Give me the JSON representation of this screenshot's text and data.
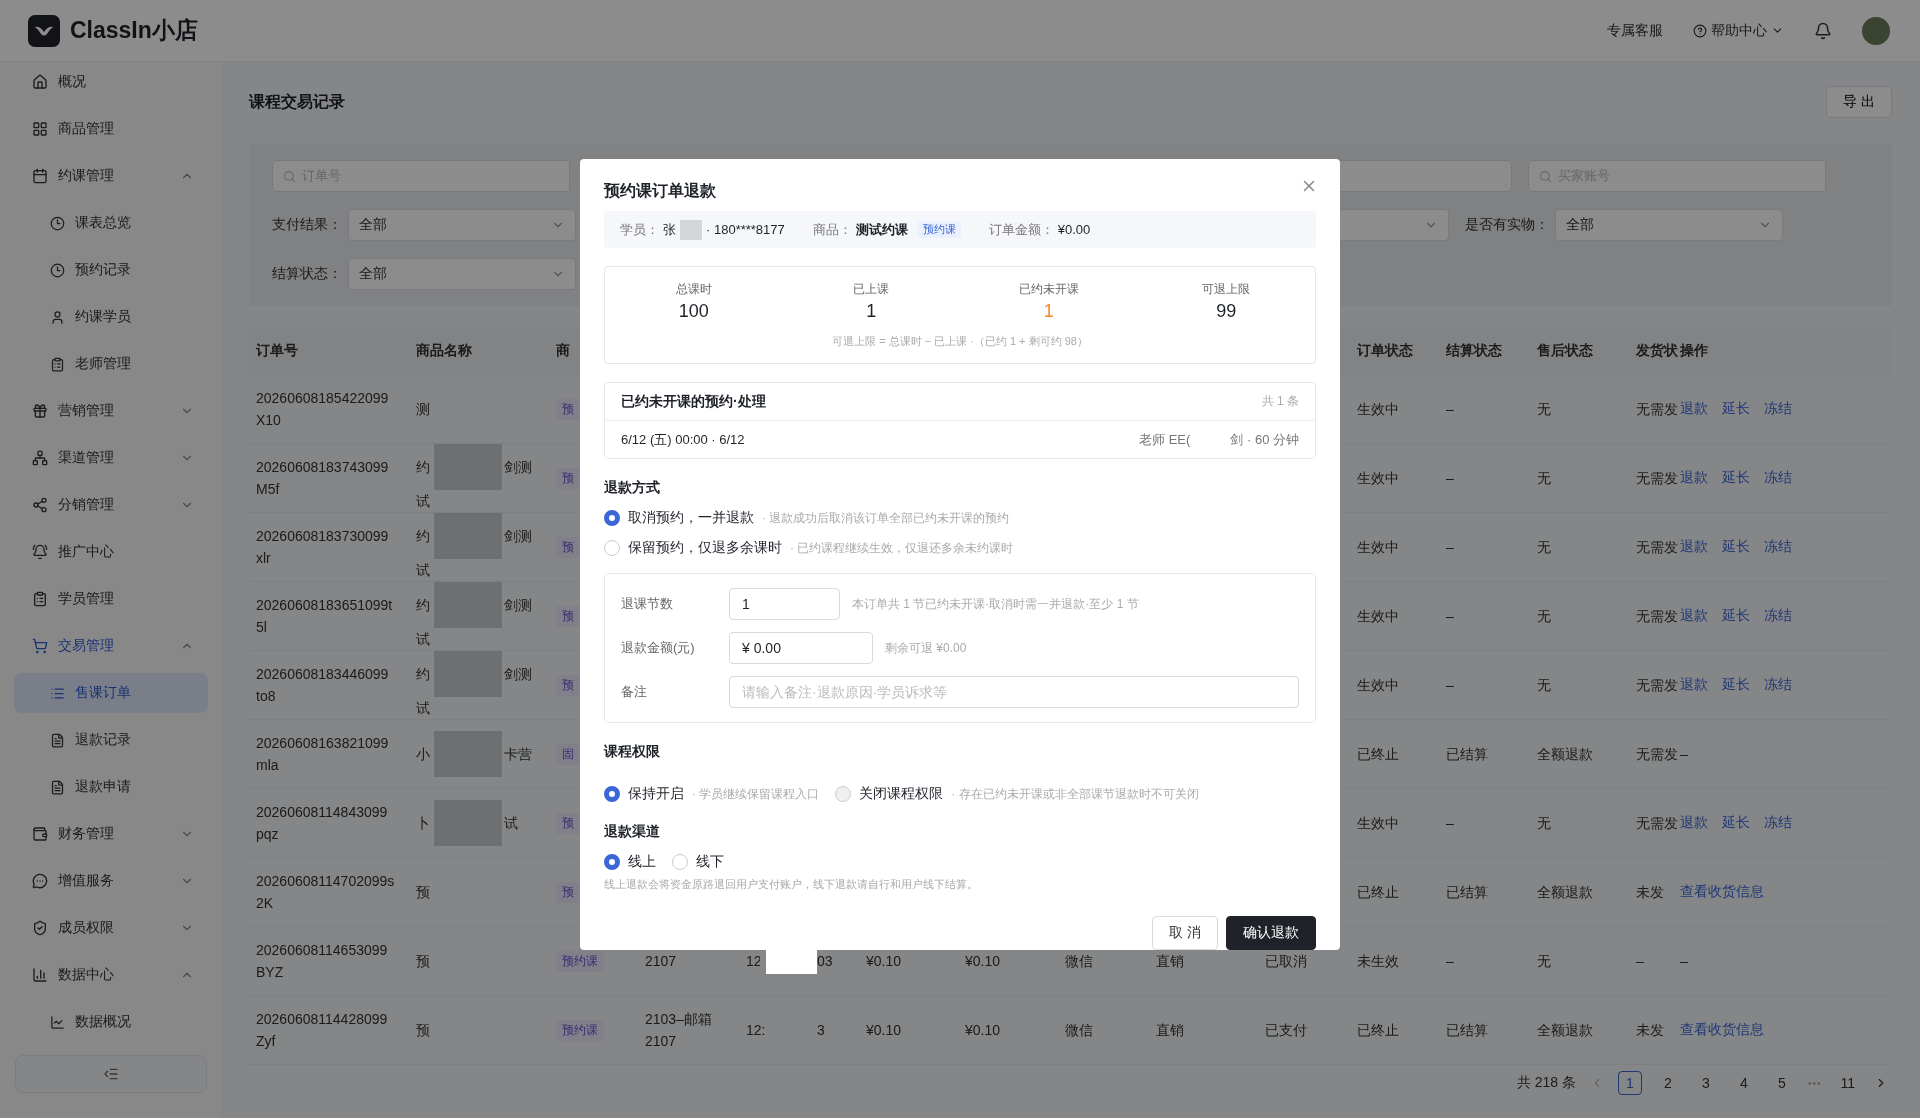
{
  "header": {
    "brand": "ClassIn小店",
    "service": "专属客服",
    "help": "帮助中心"
  },
  "sidebar": {
    "items": [
      {
        "label": "概况",
        "selected": false
      },
      {
        "label": "商品管理",
        "selected": false
      },
      {
        "label": "约课管理",
        "selected": false,
        "expanded": true,
        "children": [
          {
            "label": "课表总览",
            "selected": false
          },
          {
            "label": "预约记录",
            "selected": false
          },
          {
            "label": "约课学员",
            "selected": false
          },
          {
            "label": "老师管理",
            "selected": false
          }
        ]
      },
      {
        "label": "营销管理",
        "selected": false,
        "expanded": false
      },
      {
        "label": "渠道管理",
        "selected": false,
        "expanded": false
      },
      {
        "label": "分销管理",
        "selected": false,
        "expanded": false
      },
      {
        "label": "推广中心",
        "selected": false
      },
      {
        "label": "学员管理",
        "selected": false
      },
      {
        "label": "交易管理",
        "selected": false,
        "expanded": true,
        "children": [
          {
            "label": "售课订单",
            "selected": true
          },
          {
            "label": "退款记录",
            "selected": false
          },
          {
            "label": "退款申请",
            "selected": false
          }
        ]
      },
      {
        "label": "财务管理",
        "selected": false,
        "expanded": false
      },
      {
        "label": "增值服务",
        "selected": false,
        "expanded": false
      },
      {
        "label": "成员权限",
        "selected": false,
        "expanded": false
      },
      {
        "label": "数据中心",
        "selected": false,
        "expanded": true,
        "children": [
          {
            "label": "数据概况",
            "selected": false
          }
        ]
      }
    ]
  },
  "page": {
    "title": "课程交易记录",
    "export_button": "导 出"
  },
  "filters": {
    "row_1": [
      {
        "kind": "search",
        "placeholder": "订单号"
      },
      {
        "kind": "blank"
      },
      {
        "kind": "search",
        "placeholder": "买家账号"
      }
    ],
    "row_2": [
      {
        "kind": "select",
        "label": "支付结果：",
        "value": "全部"
      },
      {
        "kind": "blank_select"
      },
      {
        "kind": "select",
        "label": "是否有实物：",
        "value": "全部"
      }
    ],
    "row_3": [
      {
        "kind": "select",
        "label": "结算状态：",
        "value": "全部"
      }
    ]
  },
  "table": {
    "columns": {
      "order_no": "订单号",
      "name": "商品名称",
      "type": "商",
      "order_status": "订单状态",
      "settle_status": "结算状态",
      "aftersale_status": "售后状态",
      "shipping_status": "发货状",
      "actions": "操作"
    },
    "rows": [
      {
        "order_no": "20260608185422099\nX10",
        "name": {
          "head": "测"
        },
        "type": "预",
        "order_status": "生效中",
        "settle_status": "–",
        "aftersale_status": "无",
        "shipping_status": "无需发",
        "actions": [
          {
            "label": "退款",
            "kind": "link"
          },
          {
            "label": "延长",
            "kind": "link"
          },
          {
            "label": "冻结",
            "kind": "link"
          }
        ]
      },
      {
        "order_no": "20260608183743099\nM5f",
        "name": {
          "head": "约",
          "tail": "剑测",
          "second_line": "试"
        },
        "type": "预",
        "order_status": "生效中",
        "settle_status": "–",
        "aftersale_status": "无",
        "shipping_status": "无需发",
        "actions": [
          {
            "label": "退款",
            "kind": "link"
          },
          {
            "label": "延长",
            "kind": "link"
          },
          {
            "label": "冻结",
            "kind": "link"
          }
        ]
      },
      {
        "order_no": "20260608183730099\nxlr",
        "name": {
          "head": "约",
          "tail": "剑测",
          "second_line": "试"
        },
        "type": "预",
        "order_status": "生效中",
        "settle_status": "–",
        "aftersale_status": "无",
        "shipping_status": "无需发",
        "actions": [
          {
            "label": "退款",
            "kind": "link"
          },
          {
            "label": "延长",
            "kind": "link"
          },
          {
            "label": "冻结",
            "kind": "link"
          }
        ]
      },
      {
        "order_no": "20260608183651099t\n5l",
        "name": {
          "head": "约",
          "tail": "剑测",
          "second_line": "试"
        },
        "type": "预",
        "order_status": "生效中",
        "settle_status": "–",
        "aftersale_status": "无",
        "shipping_status": "无需发",
        "actions": [
          {
            "label": "退款",
            "kind": "link"
          },
          {
            "label": "延长",
            "kind": "link"
          },
          {
            "label": "冻结",
            "kind": "link"
          }
        ]
      },
      {
        "order_no": "20260608183446099\nto8",
        "name": {
          "head": "约",
          "tail": "剑测",
          "second_line": "试"
        },
        "type": "预",
        "order_status": "生效中",
        "settle_status": "–",
        "aftersale_status": "无",
        "shipping_status": "无需发",
        "actions": [
          {
            "label": "退款",
            "kind": "link"
          },
          {
            "label": "延长",
            "kind": "link"
          },
          {
            "label": "冻结",
            "kind": "link"
          }
        ]
      },
      {
        "order_no": "20260608163821099\nmla",
        "name": {
          "head": "小",
          "tail": "卡营"
        },
        "type": "固",
        "order_status": "已终止",
        "settle_status": "已结算",
        "aftersale_status": "全额退款",
        "shipping_status": "无需发",
        "actions": [
          {
            "label": "–",
            "kind": "dash"
          }
        ]
      },
      {
        "order_no": "20260608114843099\npqz",
        "name": {
          "head": "卜",
          "tail": "试"
        },
        "type": "预",
        "order_status": "生效中",
        "settle_status": "–",
        "aftersale_status": "无",
        "shipping_status": "无需发",
        "actions": [
          {
            "label": "退款",
            "kind": "link"
          },
          {
            "label": "延长",
            "kind": "link"
          },
          {
            "label": "冻结",
            "kind": "link"
          }
        ]
      },
      {
        "order_no": "20260608114702099s\n2K",
        "name": {
          "head": "预"
        },
        "type": "预",
        "order_status": "已终止",
        "settle_status": "已结算",
        "aftersale_status": "全额退款",
        "shipping_status": "未发",
        "actions": [
          {
            "label": "查看收货信息",
            "kind": "link"
          }
        ]
      },
      {
        "order_no": "20260608114653099\nBYZ",
        "name": {
          "head": "预"
        },
        "type": "预约课",
        "column_4": "2107",
        "column_5": "12",
        "column_5_redacted": true,
        "column_6": "03",
        "column_7": "¥0.10",
        "column_8": "¥0.10",
        "column_9": "微信",
        "column_10": "直销",
        "column_11": "已取消",
        "order_status": "未生效",
        "settle_status": "–",
        "aftersale_status": "无",
        "shipping_status": "–",
        "actions": [
          {
            "label": "–",
            "kind": "dash"
          }
        ]
      },
      {
        "order_no": "20260608114428099\nZyf",
        "name": {
          "head": "预"
        },
        "type": "预约课",
        "column_4": "2103–邮箱\n2107",
        "column_5": "12:",
        "column_6": "3",
        "column_7": "¥0.10",
        "column_8": "¥0.10",
        "column_9": "微信",
        "column_10": "直销",
        "column_11": "已支付",
        "order_status": "已终止",
        "settle_status": "已结算",
        "aftersale_status": "全额退款",
        "shipping_status": "未发",
        "actions": [
          {
            "label": "查看收货信息",
            "kind": "link"
          }
        ]
      }
    ]
  },
  "pagination": {
    "total": "共 218 条",
    "pages": [
      {
        "label": "1",
        "kind": "page",
        "selected": true
      },
      {
        "label": "2",
        "kind": "page",
        "selected": false
      },
      {
        "label": "3",
        "kind": "page",
        "selected": false
      },
      {
        "label": "4",
        "kind": "page",
        "selected": false
      },
      {
        "label": "5",
        "kind": "page",
        "selected": false
      },
      {
        "label": "•••",
        "kind": "ellipsis"
      },
      {
        "label": "11",
        "kind": "page",
        "selected": false
      }
    ]
  },
  "refund_dialog": {
    "title": "预约课订单退款",
    "student_label": "学员：",
    "student_name": "张",
    "student_phone": "· 180****8177",
    "product_label": "商品：",
    "product_name": "测试约课",
    "product_tag": "预约课",
    "amount_label": "订单金额：",
    "amount": "¥0.00",
    "stats": [
      {
        "label": "总课时",
        "value": "100",
        "highlight": false
      },
      {
        "label": "已上课",
        "value": "1",
        "highlight": false
      },
      {
        "label": "已约未开课",
        "value": "1",
        "highlight": true
      },
      {
        "label": "可退上限",
        "value": "99",
        "highlight": false
      }
    ],
    "stats_note": "可退上限 = 总课时 − 已上课 ·（已约 1 + 剩可约 98）",
    "bookings": {
      "title": "已约未开课的预约·处理",
      "count": "共 1 条",
      "rows": [
        {
          "time": "6/12 (五) 00:00 · 6/12",
          "teacher": "老师 EE(",
          "detail": "剑 · 60 分钟"
        }
      ]
    },
    "refund_method": {
      "title": "退款方式",
      "options": [
        {
          "label": "取消预约，一并退款",
          "hint": "· 退款成功后取消该订单全部已约未开课的预约",
          "selected": true
        },
        {
          "label": "保留预约，仅退多余课时",
          "hint": "· 已约课程继续生效，仅退还多余未约课时",
          "selected": false
        }
      ]
    },
    "form": [
      {
        "label": "退课节数",
        "value": "1",
        "hint": "本订单共 1 节已约未开课·取消时需一并退款·至少 1 节",
        "kind": "short"
      },
      {
        "label": "退款金额(元)",
        "value": "¥ 0.00",
        "hint": "剩余可退 ¥0.00",
        "kind": "medium"
      },
      {
        "label": "备注",
        "placeholder": "请输入备注·退款原因·学员诉求等",
        "kind": "wide"
      }
    ],
    "course_access": {
      "title": "课程权限",
      "options": [
        {
          "label": "保持开启",
          "hint": "· 学员继续保留课程入口",
          "selected": true,
          "disabled": false
        },
        {
          "label": "关闭课程权限",
          "hint": "· 存在已约未开课或非全部课节退款时不可关闭",
          "selected": false,
          "disabled": true
        }
      ]
    },
    "refund_channel": {
      "title": "退款渠道",
      "options": [
        {
          "label": "线上",
          "selected": true
        },
        {
          "label": "线下",
          "selected": false
        }
      ],
      "note": "线上退款会将资金原路退回用户支付账户，线下退款请自行和用户线下结算。"
    },
    "buttons": [
      {
        "label": "取 消",
        "kind": "secondary"
      },
      {
        "label": "确认退款",
        "kind": "primary"
      }
    ]
  }
}
